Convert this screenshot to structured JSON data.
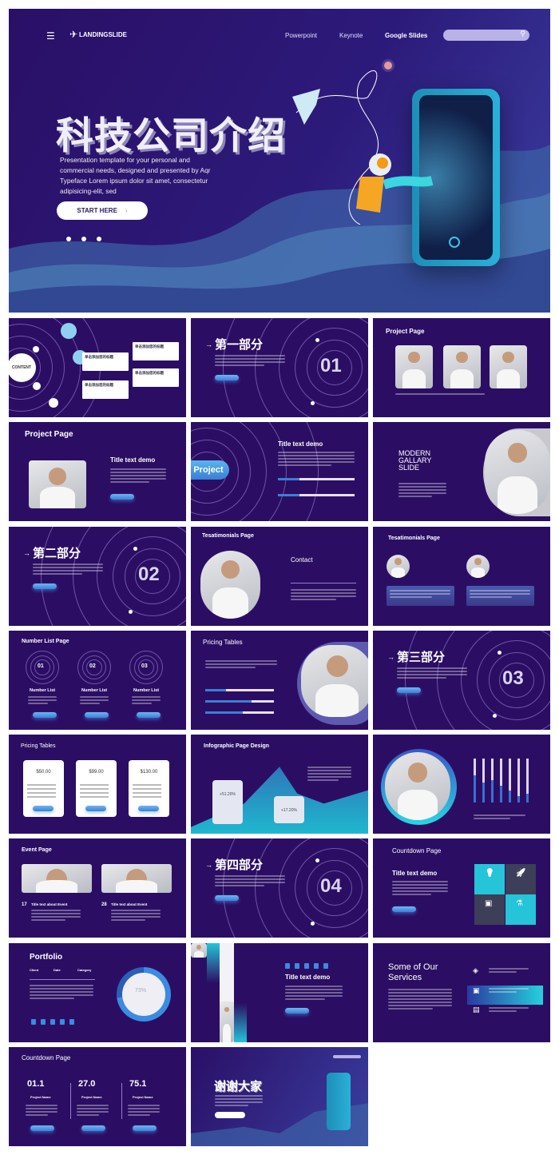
{
  "colors": {
    "background": "#2b0e63",
    "accent_blue": "#3b7fd6",
    "accent_cyan": "#1fc7d8",
    "text": "#ffffff"
  },
  "hero": {
    "brand": "LANDINGSLIDE",
    "nav": [
      "Powerpoint",
      "Keynote",
      "Google Slides"
    ],
    "title": "科技公司介绍",
    "description": "Presentation template for your personal and commercial needs, designed and presented by Aqr Typeface Lorem ipsum dolor sit amet, consectetur adipisicing-elit, sed",
    "cta": "START HERE",
    "icons": [
      "menu-icon",
      "rocket-icon",
      "search-icon",
      "chevron-right-icon"
    ]
  },
  "slides": {
    "s1": {
      "center": "CONTENT",
      "card": "单击添加您的标题"
    },
    "s2": {
      "heading": "第一部分",
      "number": "01"
    },
    "s3": {
      "title": "Project Page"
    },
    "s4": {
      "title": "Project Page",
      "subtitle": "Title text demo"
    },
    "s5": {
      "pill": "Project",
      "title": "Title text demo",
      "progress": [
        28,
        28
      ]
    },
    "s6": {
      "title": "MODERN GALLARY SLIDE"
    },
    "s7": {
      "heading": "第二部分",
      "number": "02"
    },
    "s8": {
      "title": "Tesatimonials Page",
      "contact": "Contact"
    },
    "s9": {
      "title": "Tesatimonials Page"
    },
    "s10": {
      "title": "Number List Page",
      "numbers": [
        "01",
        "02",
        "03"
      ],
      "label": "Number List"
    },
    "s11": {
      "title": "Pricing Tables",
      "progress": [
        30,
        68,
        55
      ]
    },
    "s12": {
      "heading": "第三部分",
      "number": "03"
    },
    "s13": {
      "title": "Pricing Tables",
      "prices": [
        "$50.00",
        "$99.00",
        "$130.00"
      ]
    },
    "s14": {
      "title": "Infographic Page Design",
      "stats": [
        "+51.20%",
        "+17.20%"
      ]
    },
    "s15": {
      "bars": [
        62,
        45,
        52,
        38,
        28,
        15,
        20
      ]
    },
    "s16": {
      "title": "Event Page",
      "events": [
        {
          "day": "17",
          "title": "Title text about Event"
        },
        {
          "day": "28",
          "title": "Title text about Event"
        }
      ]
    },
    "s17": {
      "heading": "第四部分",
      "number": "04"
    },
    "s18": {
      "title": "Countdown Page",
      "subtitle": "Title text demo"
    },
    "s19": {
      "title": "Portfolio",
      "meta": [
        "Client",
        "Date",
        "Category"
      ],
      "percent": "73%",
      "percent_value": 73
    },
    "s20": {
      "title": "Title text demo"
    },
    "s21": {
      "title": "Some of Our Services"
    },
    "s22": {
      "title": "Countdown Page",
      "values": [
        "01.1",
        "27.0",
        "75.1"
      ],
      "label": "Project Name"
    },
    "s23": {
      "title": "谢谢大家",
      "cta": "START HERE"
    }
  }
}
